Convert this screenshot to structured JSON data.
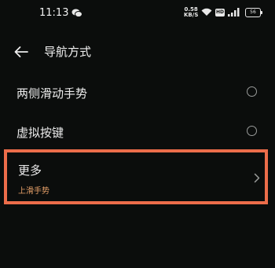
{
  "status_bar": {
    "time": "11:13",
    "net_speed_value": "0.58",
    "net_speed_unit": "KB/S",
    "hd_label": "HD",
    "battery_level": "56"
  },
  "header": {
    "title": "导航方式"
  },
  "options": [
    {
      "label": "两侧滑动手势"
    },
    {
      "label": "虚拟按键"
    }
  ],
  "more": {
    "title": "更多",
    "subtitle": "上滑手势"
  },
  "colors": {
    "background": "#0b0d0c",
    "highlight_border": "#ec6d4a",
    "subtitle": "#e9a26a"
  }
}
